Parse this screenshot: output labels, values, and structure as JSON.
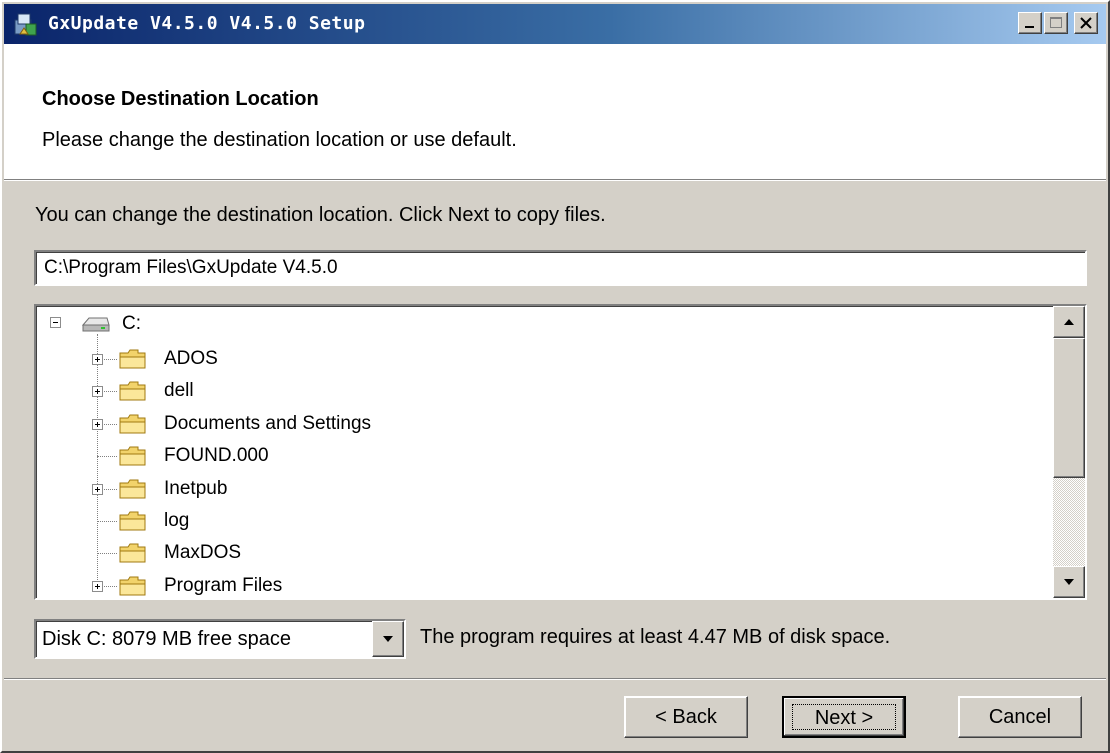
{
  "window": {
    "title": "GxUpdate V4.5.0 V4.5.0 Setup"
  },
  "header": {
    "title": "Choose Destination Location",
    "subtitle": "Please change the destination location or use default."
  },
  "body": {
    "instruction": "You can change the destination location. Click Next to copy files.",
    "path_value": "C:\\Program Files\\GxUpdate V4.5.0",
    "tree": {
      "root": "C:",
      "items": [
        {
          "label": "ADOS",
          "expandable": true
        },
        {
          "label": "dell",
          "expandable": true
        },
        {
          "label": "Documents and Settings",
          "expandable": true
        },
        {
          "label": "FOUND.000",
          "expandable": false
        },
        {
          "label": "Inetpub",
          "expandable": true
        },
        {
          "label": "log",
          "expandable": false
        },
        {
          "label": "MaxDOS",
          "expandable": false
        },
        {
          "label": "Program Files",
          "expandable": true
        }
      ]
    },
    "drive_select": "Disk C: 8079 MB free space",
    "requirement": "The program requires at least  4.47 MB of disk space."
  },
  "buttons": {
    "back": "< Back",
    "next": "Next >",
    "cancel": "Cancel"
  },
  "icons": {
    "folder_color": "#f2d36b",
    "title_gradient_start": "#0a246a",
    "title_gradient_end": "#a6caf0"
  }
}
